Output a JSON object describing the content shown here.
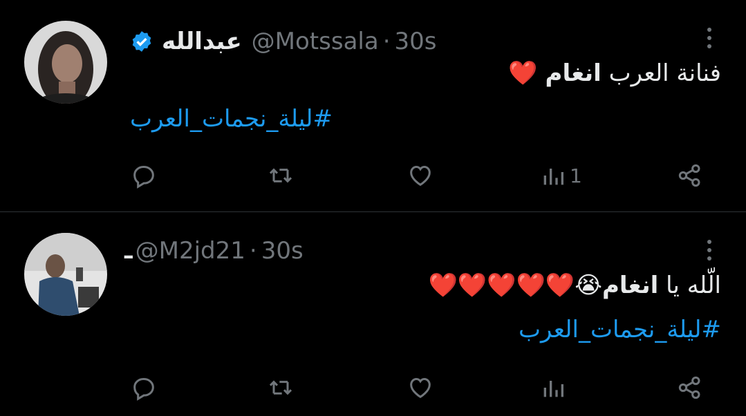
{
  "tweets": [
    {
      "display_name": "عبدالله",
      "handle": "@Motssala",
      "separator": "·",
      "time": "30s",
      "verified": true,
      "text_prefix": "فنانة العرب ",
      "text_bold": "انغام",
      "text_suffix": " ❤️",
      "hashtag": "#ليلة_نجمات_العرب",
      "views": "1"
    },
    {
      "display_name": "ـ",
      "handle": "@M2jd21",
      "separator": "·",
      "time": "30s",
      "verified": false,
      "text_prefix": "الّله يا ",
      "text_bold": "انغام",
      "text_suffix": "😭❤️❤️❤️❤️❤️",
      "hashtag": "#ليلة_نجمات_العرب",
      "views": ""
    }
  ],
  "colors": {
    "link": "#1d9bf0",
    "muted": "#71767b",
    "verified": "#1d9bf0"
  },
  "icons": [
    "verified-badge-icon",
    "more-icon",
    "reply-icon",
    "retweet-icon",
    "like-icon",
    "views-icon",
    "share-icon"
  ]
}
